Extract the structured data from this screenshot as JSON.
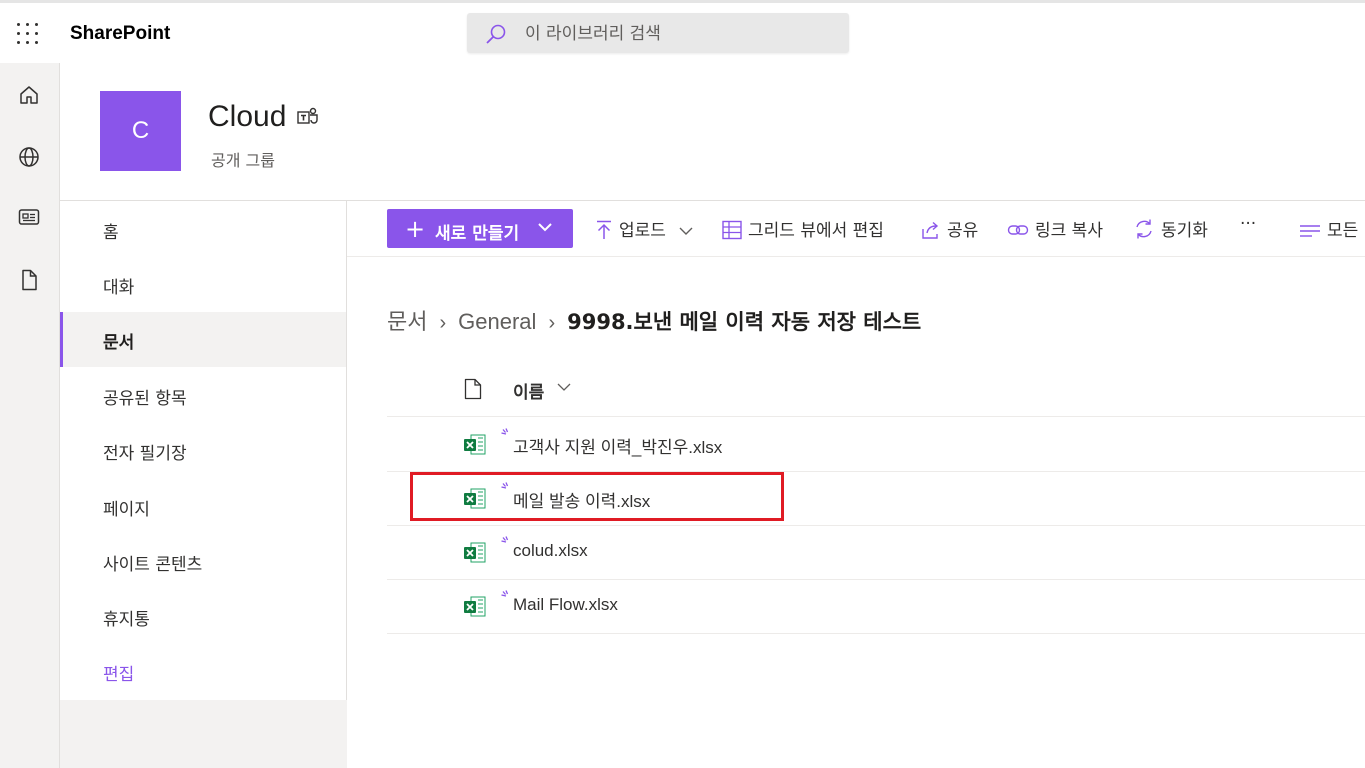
{
  "topbar": {
    "app_name": "SharePoint",
    "search_placeholder": "이 라이브러리 검색"
  },
  "rail": {
    "icons": [
      "home-icon",
      "globe-icon",
      "news-icon",
      "document-icon"
    ]
  },
  "site": {
    "logo_letter": "C",
    "title": "Cloud",
    "subtitle": "공개 그룹",
    "accent_color": "#8a55ea"
  },
  "leftnav": {
    "items": [
      {
        "label": "홈",
        "active": false
      },
      {
        "label": "대화",
        "active": false
      },
      {
        "label": "문서",
        "active": true
      },
      {
        "label": "공유된 항목",
        "active": false
      },
      {
        "label": "전자 필기장",
        "active": false
      },
      {
        "label": "페이지",
        "active": false
      },
      {
        "label": "사이트 콘텐츠",
        "active": false
      },
      {
        "label": "휴지통",
        "active": false
      }
    ],
    "edit_label": "편집"
  },
  "commandbar": {
    "new_label": "새로 만들기",
    "upload_label": "업로드",
    "grid_edit_label": "그리드 뷰에서 편집",
    "share_label": "공유",
    "copy_link_label": "링크 복사",
    "sync_label": "동기화",
    "more_label": "···",
    "view_label": "모든"
  },
  "breadcrumb": {
    "items": [
      "문서",
      "General"
    ],
    "current": "9998.보낸 메일 이력 자동 저장 테스트"
  },
  "list": {
    "name_header": "이름",
    "files": [
      {
        "name": "고객사 지원 이력_박진우.xlsx",
        "type": "excel-file-icon"
      },
      {
        "name": "메일 발송 이력.xlsx",
        "type": "excel-file-icon",
        "highlighted": true
      },
      {
        "name": "colud.xlsx",
        "type": "excel-file-icon"
      },
      {
        "name": "Mail Flow.xlsx",
        "type": "excel-file-icon"
      }
    ]
  },
  "colors": {
    "highlight_border": "#e01b24",
    "excel_green": "#107c41"
  }
}
